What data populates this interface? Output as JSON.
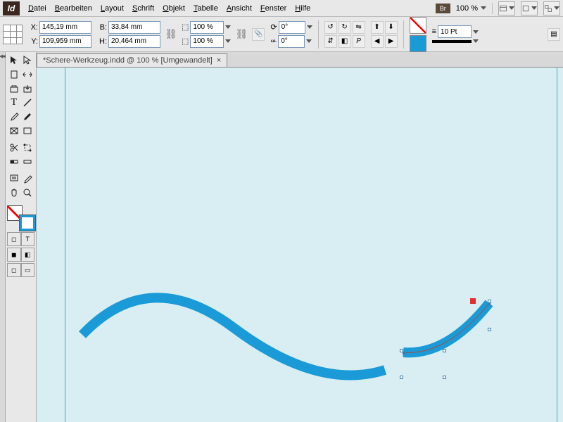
{
  "menu": {
    "items": [
      "Datei",
      "Bearbeiten",
      "Layout",
      "Schrift",
      "Objekt",
      "Tabelle",
      "Ansicht",
      "Fenster",
      "Hilfe"
    ],
    "bridge": "Br",
    "zoom": "100 %"
  },
  "controls": {
    "x": "145,19 mm",
    "y": "109,959 mm",
    "w": "33,84 mm",
    "h": "20,464 mm",
    "x_label": "X:",
    "y_label": "Y:",
    "w_label": "B:",
    "h_label": "H:",
    "scale_x": "100 %",
    "scale_y": "100 %",
    "rotate": "0°",
    "shear": "0°",
    "stroke_weight": "10 Pt"
  },
  "tab": {
    "title": "*Schere-Werkzeug.indd @ 100 % [Umgewandelt]",
    "close": "×"
  }
}
